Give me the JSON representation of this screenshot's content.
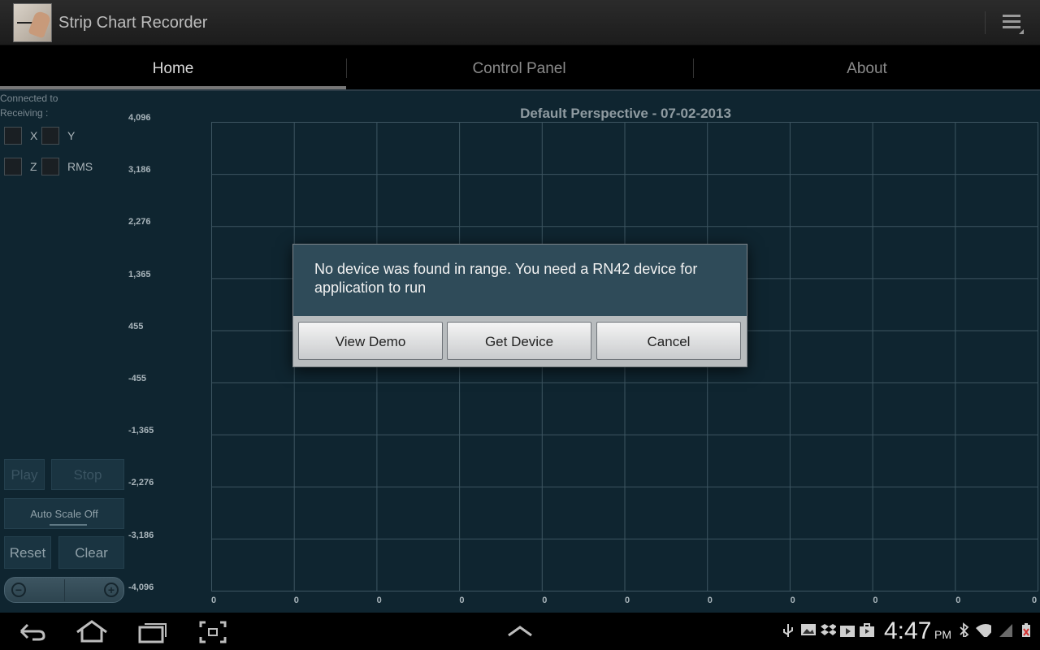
{
  "app": {
    "title": "Strip Chart Recorder"
  },
  "tabs": [
    {
      "label": "Home",
      "active": true
    },
    {
      "label": "Control Panel",
      "active": false
    },
    {
      "label": "About",
      "active": false
    }
  ],
  "status": {
    "connected": "Connected to",
    "receiving": "Receiving :"
  },
  "channels": [
    {
      "label": "X",
      "checked": false
    },
    {
      "label": "Y",
      "checked": false
    },
    {
      "label": "Z",
      "checked": false
    },
    {
      "label": "RMS",
      "checked": false
    }
  ],
  "controls": {
    "play": "Play",
    "stop": "Stop",
    "auto_scale": "Auto Scale Off",
    "reset": "Reset",
    "clear": "Clear"
  },
  "chart": {
    "title": "Default Perspective - 07-02-2013",
    "y_ticks": [
      "4,096",
      "3,186",
      "2,276",
      "1,365",
      "455",
      "-455",
      "-1,365",
      "-2,276",
      "-3,186",
      "-4,096"
    ],
    "x_ticks": [
      "0",
      "0",
      "0",
      "0",
      "0",
      "0",
      "0",
      "0",
      "0",
      "0",
      "0"
    ],
    "grid_color": "#3d5561"
  },
  "dialog": {
    "message": "No device was found in range. You need a RN42 device for application to run",
    "buttons": [
      "View Demo",
      "Get Device",
      "Cancel"
    ]
  },
  "system_bar": {
    "time": "4:47",
    "ampm": "PM",
    "nav_icons": [
      "back-icon",
      "home-icon",
      "recent-apps-icon",
      "screenshot-icon",
      "menu-up-icon"
    ],
    "status_icons": [
      "usb-icon",
      "image-icon",
      "dropbox-icon",
      "play-store-icon",
      "shopping-bag-icon",
      "bluetooth-icon",
      "wifi-icon",
      "signal-icon",
      "battery-icon"
    ]
  }
}
